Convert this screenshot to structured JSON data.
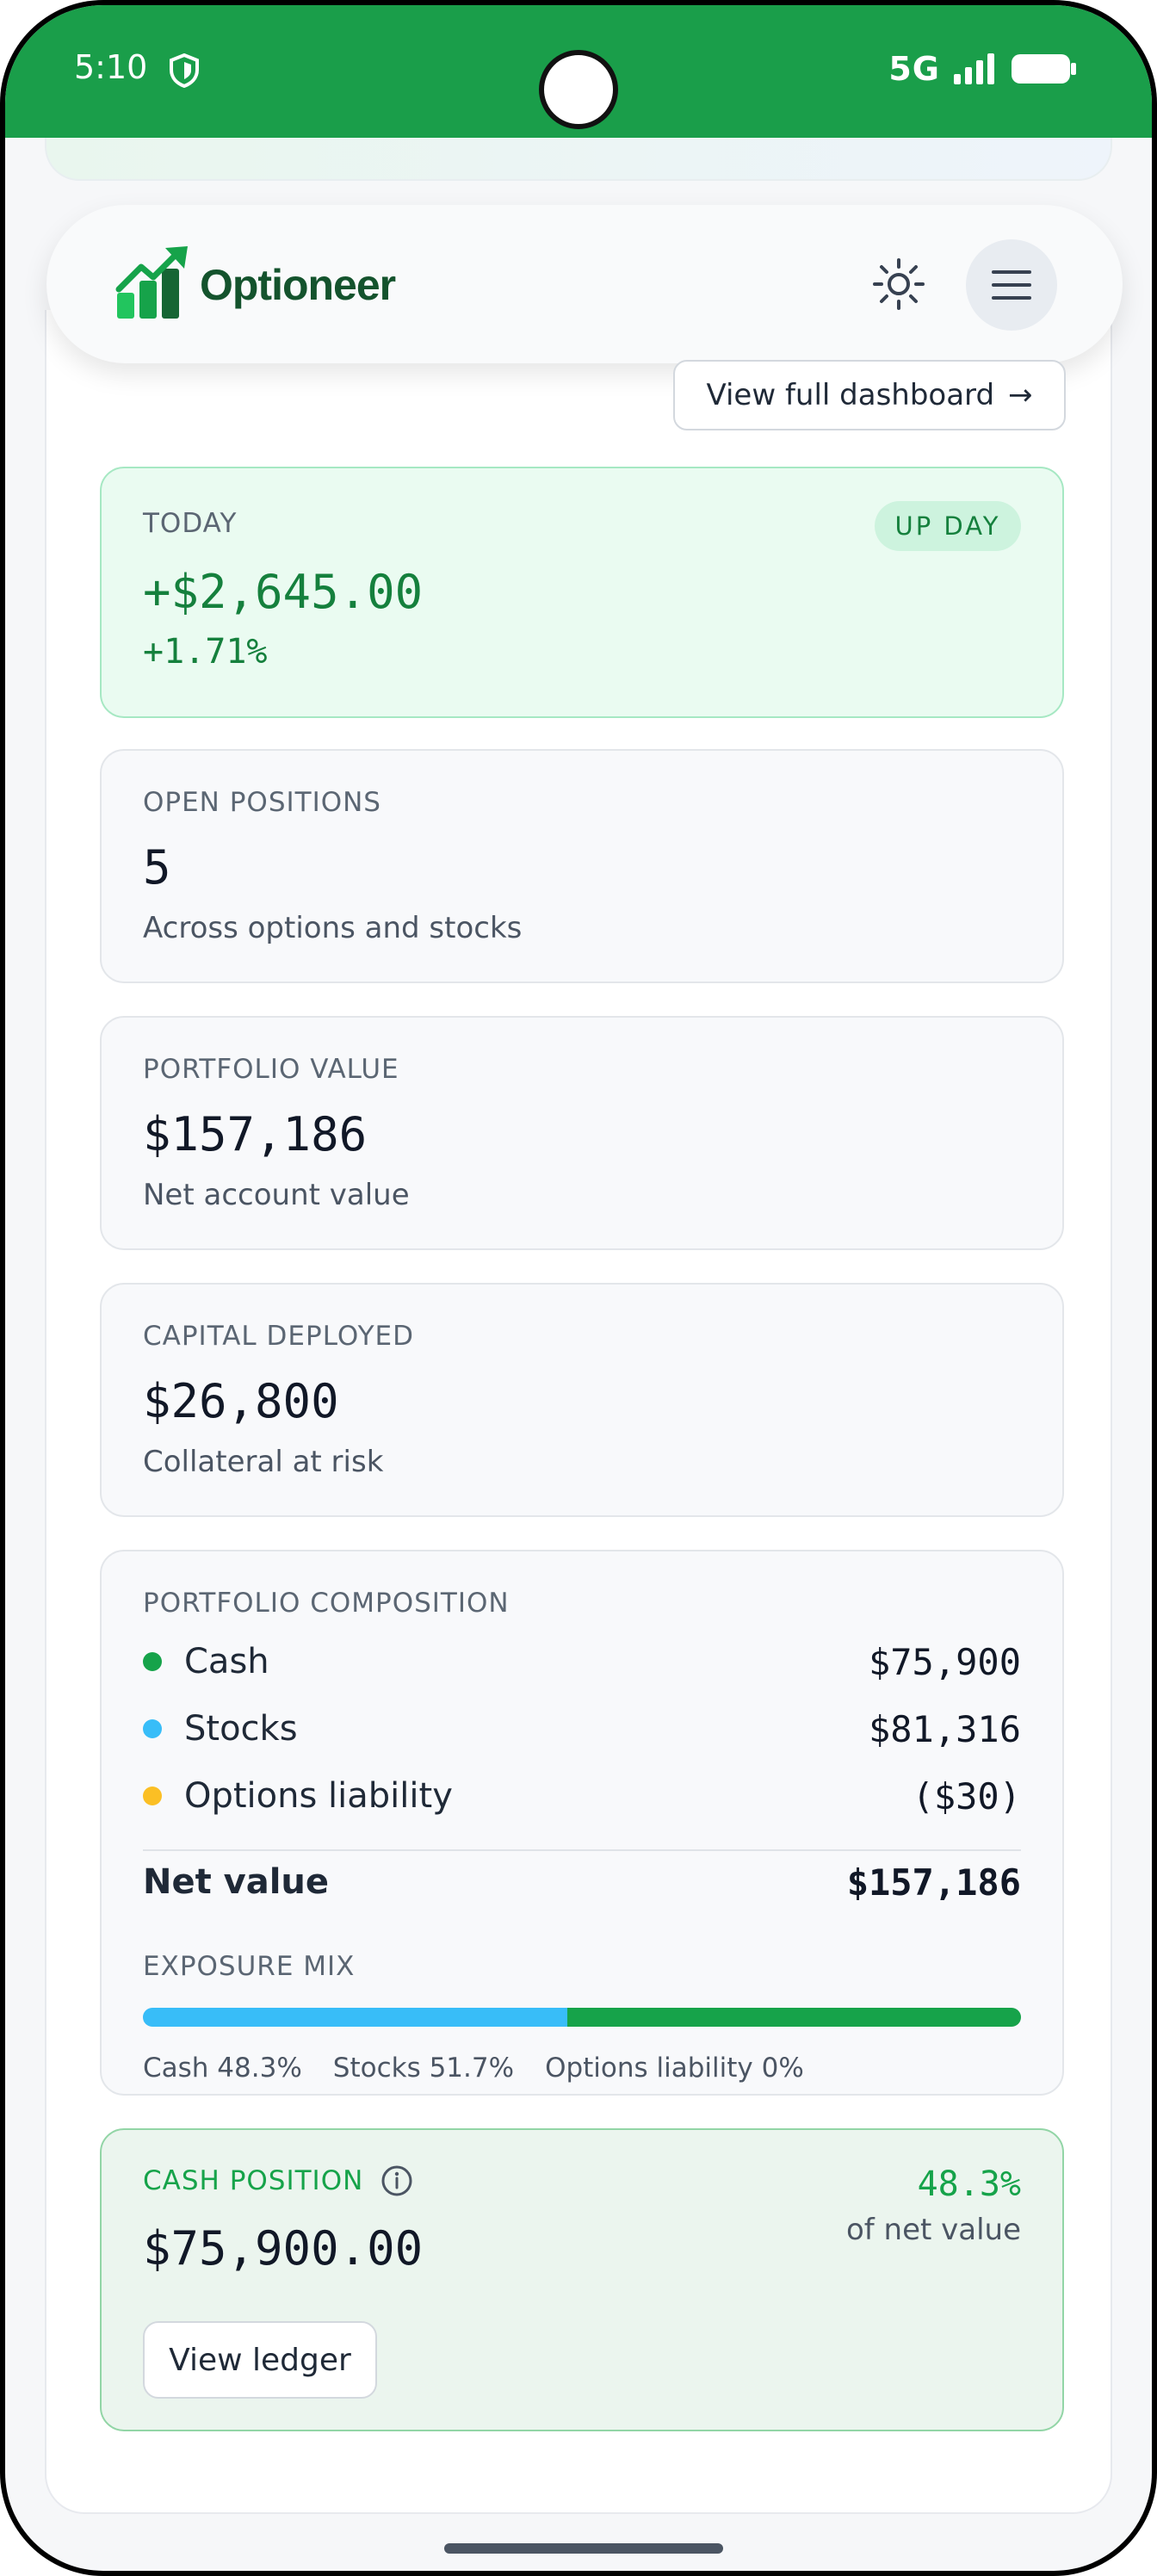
{
  "status_bar": {
    "time": "5:10",
    "network": "5G"
  },
  "app": {
    "name": "Optioneer"
  },
  "header": {
    "dashboard_link": "View full dashboard",
    "dashboard_arrow": "→"
  },
  "today": {
    "label": "TODAY",
    "badge": "UP DAY",
    "value": "+$2,645.00",
    "percent": "+1.71%"
  },
  "open_positions": {
    "label": "OPEN POSITIONS",
    "value": "5",
    "caption": "Across options and stocks"
  },
  "portfolio_value": {
    "label": "PORTFOLIO VALUE",
    "value": "$157,186",
    "caption": "Net account value"
  },
  "capital_deployed": {
    "label": "CAPITAL DEPLOYED",
    "value": "$26,800",
    "caption": "Collateral at risk"
  },
  "composition": {
    "label": "PORTFOLIO COMPOSITION",
    "items": [
      {
        "name": "Cash",
        "value": "$75,900",
        "color": "#16a34a"
      },
      {
        "name": "Stocks",
        "value": "$81,316",
        "color": "#38bdf8"
      },
      {
        "name": "Options liability",
        "value": "($30)",
        "color": "#fbbf24"
      }
    ],
    "net_label": "Net value",
    "net_value": "$157,186",
    "exposure_label": "EXPOSURE MIX",
    "exposure": [
      {
        "label": "Cash 48.3%",
        "fraction": 0.483,
        "color": "#38bdf8"
      },
      {
        "label": "Stocks 51.7%",
        "fraction": 0.517,
        "color": "#16a34a"
      },
      {
        "label": "Options liability 0%",
        "fraction": 0,
        "color": "#fbbf24"
      }
    ]
  },
  "cash_position": {
    "label": "CASH POSITION",
    "value": "$75,900.00",
    "percent": "48.3%",
    "percent_caption": "of net value",
    "button": "View ledger"
  }
}
